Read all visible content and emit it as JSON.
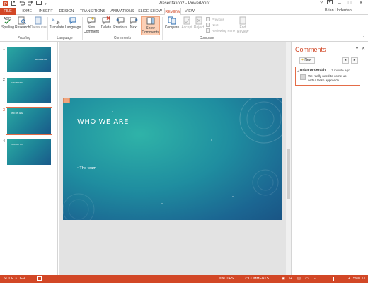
{
  "window": {
    "title": "Presentation2 - PowerPoint",
    "help": "?",
    "min": "–",
    "max": "□",
    "close": "✕",
    "user": "Brian Underdahl"
  },
  "tabs": [
    "FILE",
    "HOME",
    "INSERT",
    "DESIGN",
    "TRANSITIONS",
    "ANIMATIONS",
    "SLIDE SHOW",
    "REVIEW",
    "VIEW"
  ],
  "active_tab": "REVIEW",
  "ribbon": {
    "proofing": {
      "spelling": "Spelling",
      "research": "Research",
      "thesaurus": "Thesaurus",
      "group": "Proofing"
    },
    "language": {
      "translate": "Translate",
      "language": "Language",
      "group": "Language"
    },
    "comments": {
      "new_line1": "New",
      "new_line2": "Comment",
      "delete": "Delete",
      "previous": "Previous",
      "next": "Next",
      "show_line1": "Show",
      "show_line2": "Comments",
      "group": "Comments"
    },
    "compare": {
      "compare": "Compare",
      "accept": "Accept",
      "reject": "Reject",
      "previous": "Previous",
      "next": "Next",
      "reviewing_pane": "Reviewing Pane",
      "end_line1": "End",
      "end_line2": "Review",
      "group": "Compare"
    }
  },
  "slides": [
    {
      "num": "1",
      "title": "WHO WE ARE"
    },
    {
      "num": "2",
      "title": "OUR MISSION"
    },
    {
      "num": "3",
      "title": "WHO WE ARE"
    },
    {
      "num": "4",
      "title": "CONTACT US"
    }
  ],
  "current_slide": {
    "title": "WHO WE ARE",
    "bullet": "The team"
  },
  "comments_pane": {
    "header": "Comments",
    "new_label": "New",
    "comment": {
      "author": "Brian Underdahl",
      "time": "1 minute ago",
      "text": "We really need to come up with a fresh approach"
    }
  },
  "status": {
    "slide_info": "SLIDE 3 OF 4",
    "notes": "NOTES",
    "comments": "COMMENTS",
    "zoom": "59%"
  },
  "colors": {
    "accent": "#d24726",
    "slide_teal": "#1f8ea0"
  }
}
